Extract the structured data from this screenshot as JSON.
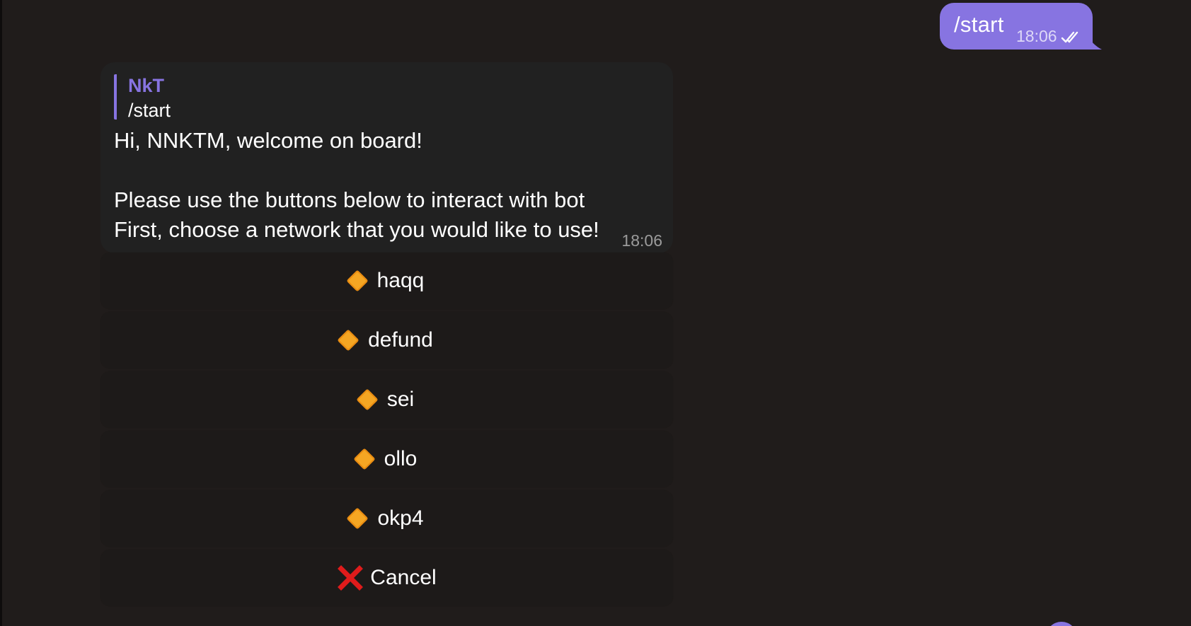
{
  "outgoing": {
    "text": "/start",
    "time": "18:06",
    "status_icon": "double-check-icon"
  },
  "incoming": {
    "reply": {
      "name": "NkT",
      "text": "/start"
    },
    "text": "Hi, NNKTM, welcome on board!\n\nPlease use the buttons below to interact with bot\nFirst, choose a network that you would like to use!",
    "time": "18:06"
  },
  "keyboard": {
    "buttons": [
      {
        "icon": "orange-diamond-icon",
        "label": "haqq"
      },
      {
        "icon": "orange-diamond-icon",
        "label": "defund"
      },
      {
        "icon": "orange-diamond-icon",
        "label": "sei"
      },
      {
        "icon": "orange-diamond-icon",
        "label": "ollo"
      },
      {
        "icon": "orange-diamond-icon",
        "label": "okp4"
      },
      {
        "icon": "red-cross-icon",
        "label": "Cancel"
      }
    ]
  },
  "colors": {
    "background": "#201c1b",
    "accent": "#8774e1",
    "incoming_bubble": "#212121",
    "button_bg": "#1d1a19",
    "diamond": "#f5a623",
    "cancel": "#e01b1b"
  }
}
